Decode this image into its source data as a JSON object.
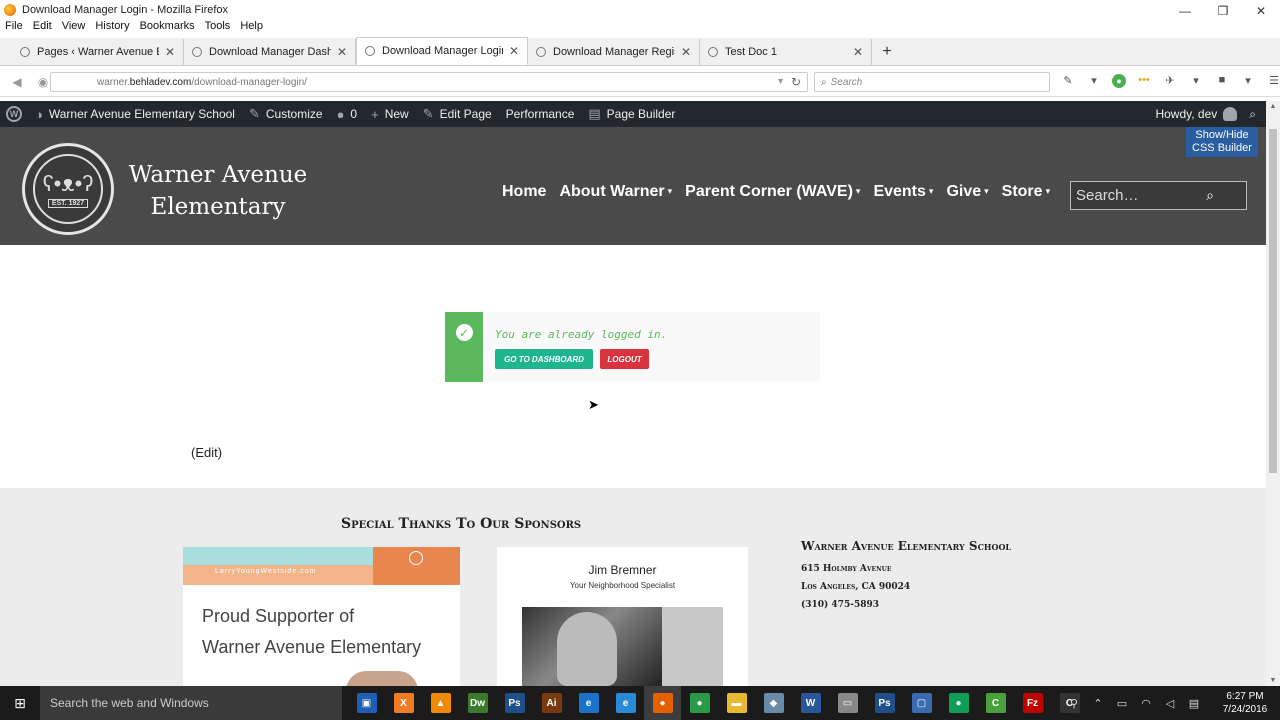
{
  "window": {
    "title": "Download Manager Login - Mozilla Firefox",
    "controls": [
      "—",
      "❐",
      "✕"
    ]
  },
  "menu": [
    "File",
    "Edit",
    "View",
    "History",
    "Bookmarks",
    "Tools",
    "Help"
  ],
  "tabs": [
    {
      "label": "Pages ‹ Warner Avenue Ele...",
      "active": false
    },
    {
      "label": "Download Manager Dashb...",
      "active": false
    },
    {
      "label": "Download Manager Login",
      "active": true
    },
    {
      "label": "Download Manager Register",
      "active": false
    },
    {
      "label": "Test Doc 1",
      "active": false
    }
  ],
  "navbar": {
    "url_prefix": "warner.",
    "url_domain": "behladev.com",
    "url_path": "/download-manager-login/",
    "search_placeholder": "Search"
  },
  "adminbar": {
    "site_name": "Warner Avenue Elementary School",
    "customize": "Customize",
    "comments_count": "0",
    "new": "New",
    "edit_page": "Edit Page",
    "performance": "Performance",
    "page_builder": "Page Builder",
    "howdy": "Howdy, dev"
  },
  "css_builder": {
    "line1": "Show/Hide",
    "line2": "CSS Builder"
  },
  "header": {
    "logo_est": "EST. 1927",
    "title_line1": "Warner Avenue",
    "title_line2": "Elementary",
    "nav": [
      {
        "label": "Home",
        "dropdown": false
      },
      {
        "label": "About Warner",
        "dropdown": true
      },
      {
        "label": "Parent Corner (WAVE)",
        "dropdown": true
      },
      {
        "label": "Events",
        "dropdown": true
      },
      {
        "label": "Give",
        "dropdown": true
      },
      {
        "label": "Store",
        "dropdown": true
      }
    ],
    "search_placeholder": "Search…"
  },
  "login_notice": {
    "message": "You are already logged in.",
    "dashboard_button": "Go to Dashboard",
    "logout_button": "Logout"
  },
  "edit_link": "(Edit)",
  "footer": {
    "sponsors_title": "Special Thanks To Our Sponsors",
    "sponsor1": {
      "url": "LarryYoungWestside.com",
      "tagline_line1": "Proud Supporter of",
      "tagline_line2": "Warner Avenue Elementary"
    },
    "sponsor2": {
      "name": "Jim Bremner",
      "tagline": "Your Neighborhood Specialist"
    },
    "school": {
      "name": "Warner Avenue Elementary School",
      "street": "615 Holmby Avenue",
      "city": "Los Angeles, CA 90024",
      "phone": "(310) 475-5893"
    }
  },
  "taskbar": {
    "search_placeholder": "Search the web and Windows",
    "apps": [
      {
        "icon": "store-icon",
        "label": "▣",
        "color": "#1e5fb4"
      },
      {
        "icon": "xampp-icon",
        "label": "X",
        "color": "#f07c28"
      },
      {
        "icon": "vlc-icon",
        "label": "▲",
        "color": "#f08a00"
      },
      {
        "icon": "dreamweaver-icon",
        "label": "Dw",
        "color": "#3a7a2a"
      },
      {
        "icon": "photoshop-icon",
        "label": "Ps",
        "color": "#1e4f8a"
      },
      {
        "icon": "illustrator-icon",
        "label": "Ai",
        "color": "#7a3a10"
      },
      {
        "icon": "edge-icon",
        "label": "e",
        "color": "#1a73c8"
      },
      {
        "icon": "ie-icon",
        "label": "e",
        "color": "#2a8ad8"
      },
      {
        "icon": "firefox-icon",
        "label": "●",
        "color": "#e66000"
      },
      {
        "icon": "chrome-icon",
        "label": "●",
        "color": "#2a9a4a"
      },
      {
        "icon": "explorer-icon",
        "label": "▬",
        "color": "#e8b830"
      },
      {
        "icon": "app-icon",
        "label": "◆",
        "color": "#6a8aaa"
      },
      {
        "icon": "word-icon",
        "label": "W",
        "color": "#2b579a"
      },
      {
        "icon": "scanner-icon",
        "label": "▭",
        "color": "#888888"
      },
      {
        "icon": "photoshop2-icon",
        "label": "Ps",
        "color": "#1e4f8a"
      },
      {
        "icon": "window-icon",
        "label": "▢",
        "color": "#3a6ab0"
      },
      {
        "icon": "hangouts-icon",
        "label": "●",
        "color": "#0f9d58"
      },
      {
        "icon": "camtasia-icon",
        "label": "C",
        "color": "#4aa03a"
      },
      {
        "icon": "filezilla-icon",
        "label": "Fz",
        "color": "#bf0000"
      },
      {
        "icon": "terminal-icon",
        "label": "C",
        "color": "#333333"
      }
    ],
    "time": "6:27 PM",
    "date": "7/24/2016"
  }
}
